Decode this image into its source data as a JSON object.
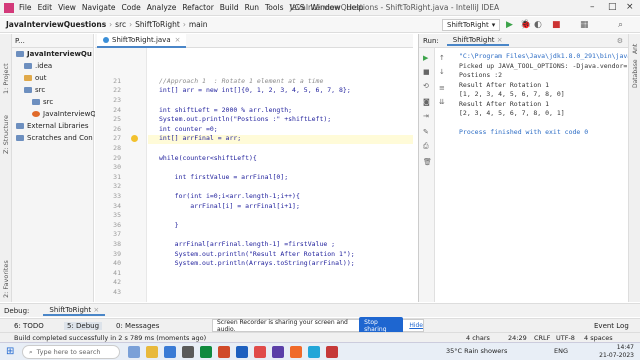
{
  "menubar": {
    "items": [
      "File",
      "Edit",
      "View",
      "Navigate",
      "Code",
      "Analyze",
      "Refactor",
      "Build",
      "Run",
      "Tools",
      "VCS",
      "Window",
      "Help"
    ],
    "title": "JavaInterviewQuestions - ShiftToRight.java - IntelliJ IDEA"
  },
  "navbar": {
    "crumbs": [
      "JavaInterviewQuestions",
      "src",
      "ShiftToRight",
      "main"
    ],
    "run_config": "ShiftToRight"
  },
  "left_strip": {
    "project": "1: Project",
    "structure": "Z: Structure",
    "favorites": "2: Favorites"
  },
  "project": {
    "header": "P...",
    "items": [
      {
        "label": "JavaInterviewQu",
        "indent": 0,
        "open": true,
        "bold": true
      },
      {
        "label": ".idea",
        "indent": 1
      },
      {
        "label": "out",
        "indent": 1,
        "orange": true
      },
      {
        "label": "src",
        "indent": 1,
        "open": true
      },
      {
        "label": "src",
        "indent": 2
      },
      {
        "label": "JavaInterviewQue",
        "indent": 2,
        "file": true
      },
      {
        "label": "External Libraries",
        "indent": 0
      },
      {
        "label": "Scratches and Con",
        "indent": 0
      }
    ]
  },
  "editor": {
    "tab": "ShiftToRight.java",
    "lines": [
      {
        "no": "",
        "text": ""
      },
      {
        "no": "",
        "text": ""
      },
      {
        "no": "",
        "text": ""
      },
      {
        "no": "21",
        "text": "//Approach 1  : Rotate 1 element at a time",
        "comment": true
      },
      {
        "no": "22",
        "text": "int[] arr = new int[]{0, 1, 2, 3, 4, 5, 6, 7, 8};"
      },
      {
        "no": "23",
        "text": ""
      },
      {
        "no": "24",
        "text": "int shiftLeft = 2000 % arr.length;",
        "current": true
      },
      {
        "no": "25",
        "text": "System.out.println(\"Postions :\" +shiftLeft);"
      },
      {
        "no": "26",
        "text": "int counter =0;"
      },
      {
        "no": "27",
        "text": "int[] arrFinal = arr;"
      },
      {
        "no": "28",
        "text": ""
      },
      {
        "no": "29",
        "text": "while(counter<shiftLeft){"
      },
      {
        "no": "30",
        "text": ""
      },
      {
        "no": "31",
        "text": "    int firstValue = arrFinal[0];"
      },
      {
        "no": "32",
        "text": ""
      },
      {
        "no": "33",
        "text": "    for(int i=0;i<arr.length-1;i++){"
      },
      {
        "no": "34",
        "text": "        arrFinal[i] = arrFinal[i+1];"
      },
      {
        "no": "35",
        "text": ""
      },
      {
        "no": "36",
        "text": "    }"
      },
      {
        "no": "37",
        "text": ""
      },
      {
        "no": "38",
        "text": "    arrFinal[arrFinal.length-1] =firstValue ;"
      },
      {
        "no": "39",
        "text": "    System.out.println(\"Result After Rotation 1\");"
      },
      {
        "no": "40",
        "text": "    System.out.println(Arrays.toString(arrFinal));"
      },
      {
        "no": "41",
        "text": ""
      },
      {
        "no": "42",
        "text": ""
      },
      {
        "no": "43",
        "text": ""
      }
    ]
  },
  "run": {
    "label": "Run:",
    "tab": "ShiftToRight",
    "output": [
      {
        "text": "\"C:\\Program Files\\Java\\jdk1.8.0_291\\bin\\java.",
        "cls": "blue"
      },
      {
        "text": "Picked up JAVA_TOOL_OPTIONS: -Djava.vendor=\"S",
        "cls": ""
      },
      {
        "text": "Postions :2",
        "cls": ""
      },
      {
        "text": "Result After Rotation 1",
        "cls": ""
      },
      {
        "text": "[1, 2, 3, 4, 5, 6, 7, 8, 0]",
        "cls": ""
      },
      {
        "text": "Result After Rotation 1",
        "cls": ""
      },
      {
        "text": "[2, 3, 4, 5, 6, 7, 8, 0, 1]",
        "cls": ""
      },
      {
        "text": "",
        "cls": ""
      },
      {
        "text": "Process finished with exit code 0",
        "cls": "blue"
      }
    ]
  },
  "debugbar": {
    "label": "Debug:",
    "tab": "ShiftToRight"
  },
  "bottomtabs": {
    "todo": "6: TODO",
    "debug": "5: Debug",
    "messages": "0: Messages",
    "event_log": "Event Log"
  },
  "notice": {
    "text": "Screen Recorder is sharing your screen and audio.",
    "stop": "Stop sharing",
    "hide": "Hide"
  },
  "status": {
    "left": "Build completed successfully in 2 s 789 ms (moments ago)",
    "chars": "4 chars",
    "pos": "24:29",
    "crlf": "CRLF",
    "enc": "UTF-8",
    "indent": "4 spaces"
  },
  "taskbar": {
    "search": "Type here to search",
    "weather": "35°C  Rain showers",
    "lang": "ENG",
    "time": "14:47",
    "date": "21-07-2023"
  }
}
